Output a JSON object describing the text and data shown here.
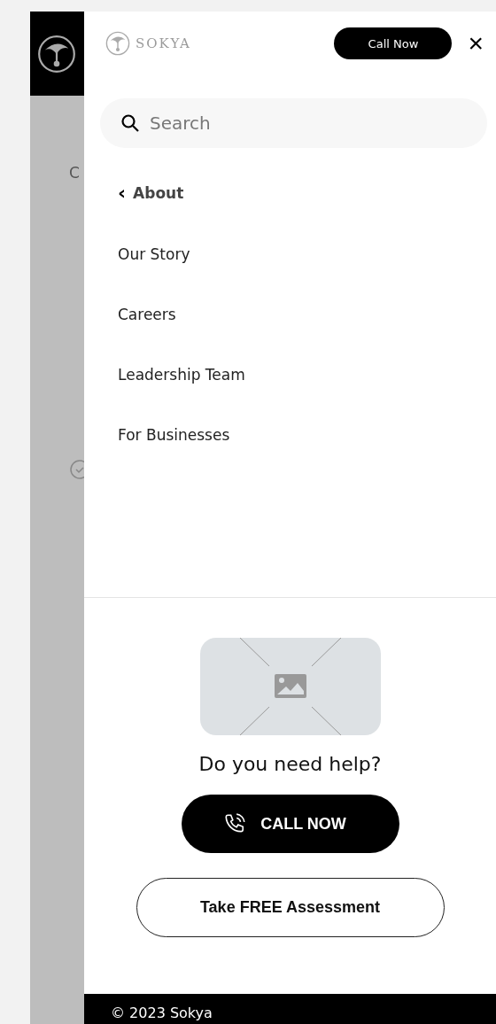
{
  "background_page": {
    "letter": "C"
  },
  "drawer": {
    "brand": "SOKYA",
    "call_button": "Call Now",
    "close": "×",
    "search": {
      "placeholder": "Search"
    },
    "back_link": {
      "icon": "‹",
      "label": "About"
    },
    "menu_items": [
      {
        "label": "Our Story"
      },
      {
        "label": "Careers"
      },
      {
        "label": "Leadership Team"
      },
      {
        "label": "For Businesses"
      }
    ],
    "help": {
      "title": "Do you need help?",
      "call_button": "CALL NOW",
      "assessment_button": "Take FREE Assessment"
    },
    "footer": "© 2023 Sokya"
  }
}
